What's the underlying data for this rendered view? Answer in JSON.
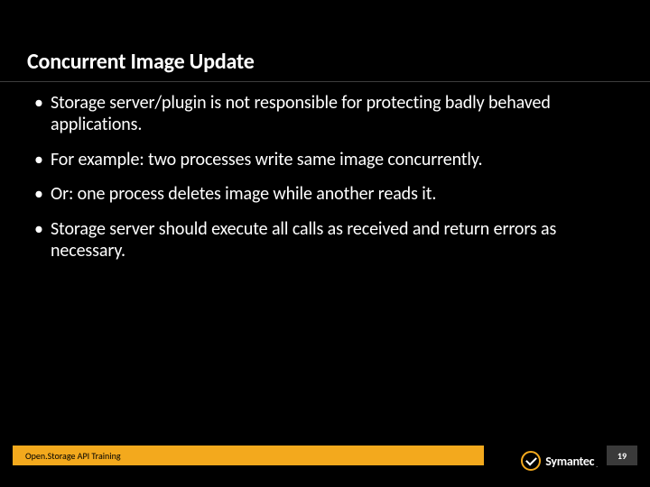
{
  "title": "Concurrent Image Update",
  "bullets": [
    "Storage server/plugin is not responsible for protecting badly behaved applications.",
    "For example: two processes write same image concurrently.",
    "Or: one process deletes image while another reads it.",
    "Storage server should execute all calls as received and return errors as necessary."
  ],
  "footer_label": "Open.Storage API Training",
  "brand": "Symantec",
  "tm": ".",
  "page_number": "19"
}
